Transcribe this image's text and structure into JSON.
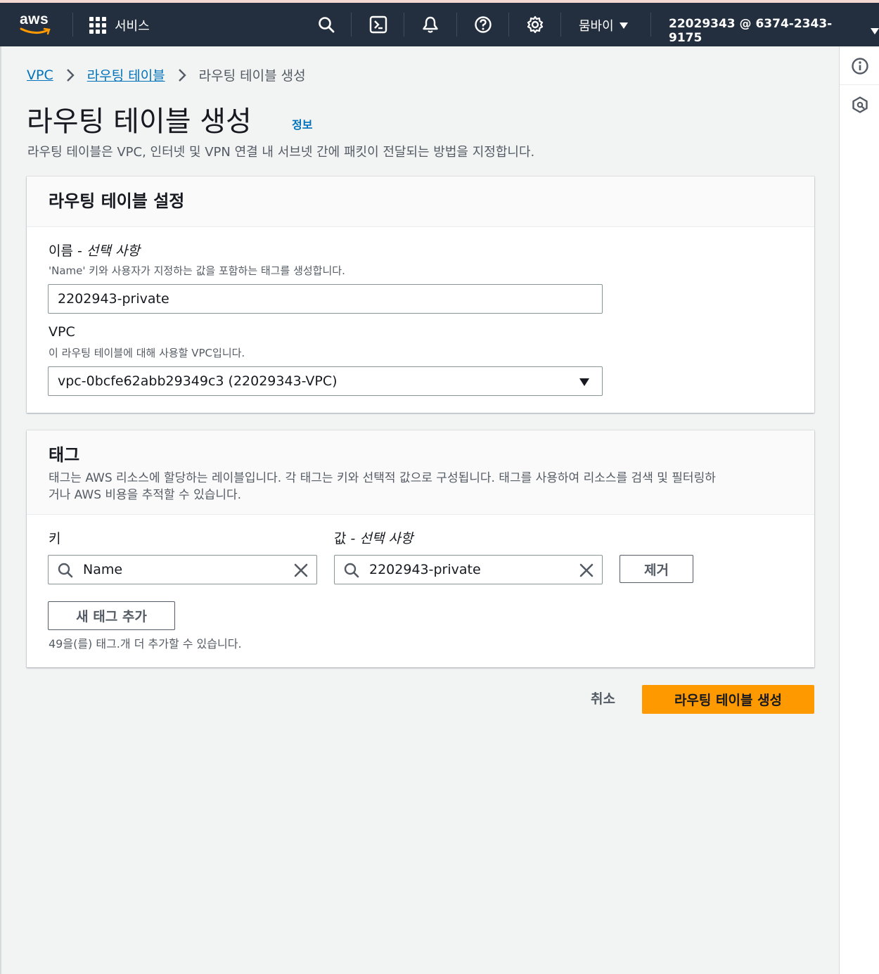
{
  "topnav": {
    "logo": "aws",
    "services_label": "서비스",
    "region_label": "뭄바이",
    "account_label": "22029343 @ 6374-2343-9175",
    "icons": [
      "search-icon",
      "cloudshell-icon",
      "notifications-bell-icon",
      "help-icon",
      "settings-gear-icon"
    ]
  },
  "breadcrumb": {
    "items": [
      "VPC",
      "라우팅 테이블"
    ],
    "current": "라우팅 테이블 생성"
  },
  "page": {
    "title": "라우팅 테이블 생성",
    "info_link": "정보",
    "description": "라우팅 테이블은 VPC, 인터넷 및 VPN 연결 내 서브넷 간에 패킷이 전달되는 방법을 지정합니다."
  },
  "settings_panel": {
    "title": "라우팅 테이블 설정",
    "name_label": "이름 - ",
    "name_optional": "선택 사항",
    "name_hint": "'Name' 키와 사용자가 지정하는 값을 포함하는 태그를 생성합니다.",
    "name_value": "2202943-private",
    "vpc_label": "VPC",
    "vpc_hint": "이 라우팅 테이블에 대해 사용할 VPC입니다.",
    "vpc_value": "vpc-0bcfe62abb29349c3 (22029343-VPC)"
  },
  "tags_panel": {
    "title": "태그",
    "description_line1": "태그는 AWS 리소스에 할당하는 레이블입니다. 각 태그는 키와 선택적 값으로 구성됩니다. 태그를 사용하여 리소스를 검색 및 필터링하",
    "description_line2": "거나 AWS 비용을 추적할 수 있습니다.",
    "key_label": "키",
    "value_label": "값 - ",
    "value_optional": "선택 사항",
    "key_value": "Name",
    "tag_value": "2202943-private",
    "remove_button": "제거",
    "add_button": "새 태그 추가",
    "remaining_hint": "49을(를) 태그.개 더 추가할 수 있습니다."
  },
  "actions": {
    "cancel": "취소",
    "submit": "라우팅 테이블 생성"
  },
  "colors": {
    "nav_bg": "#232f3e",
    "link": "#0073bb",
    "primary": "#ff9900"
  }
}
